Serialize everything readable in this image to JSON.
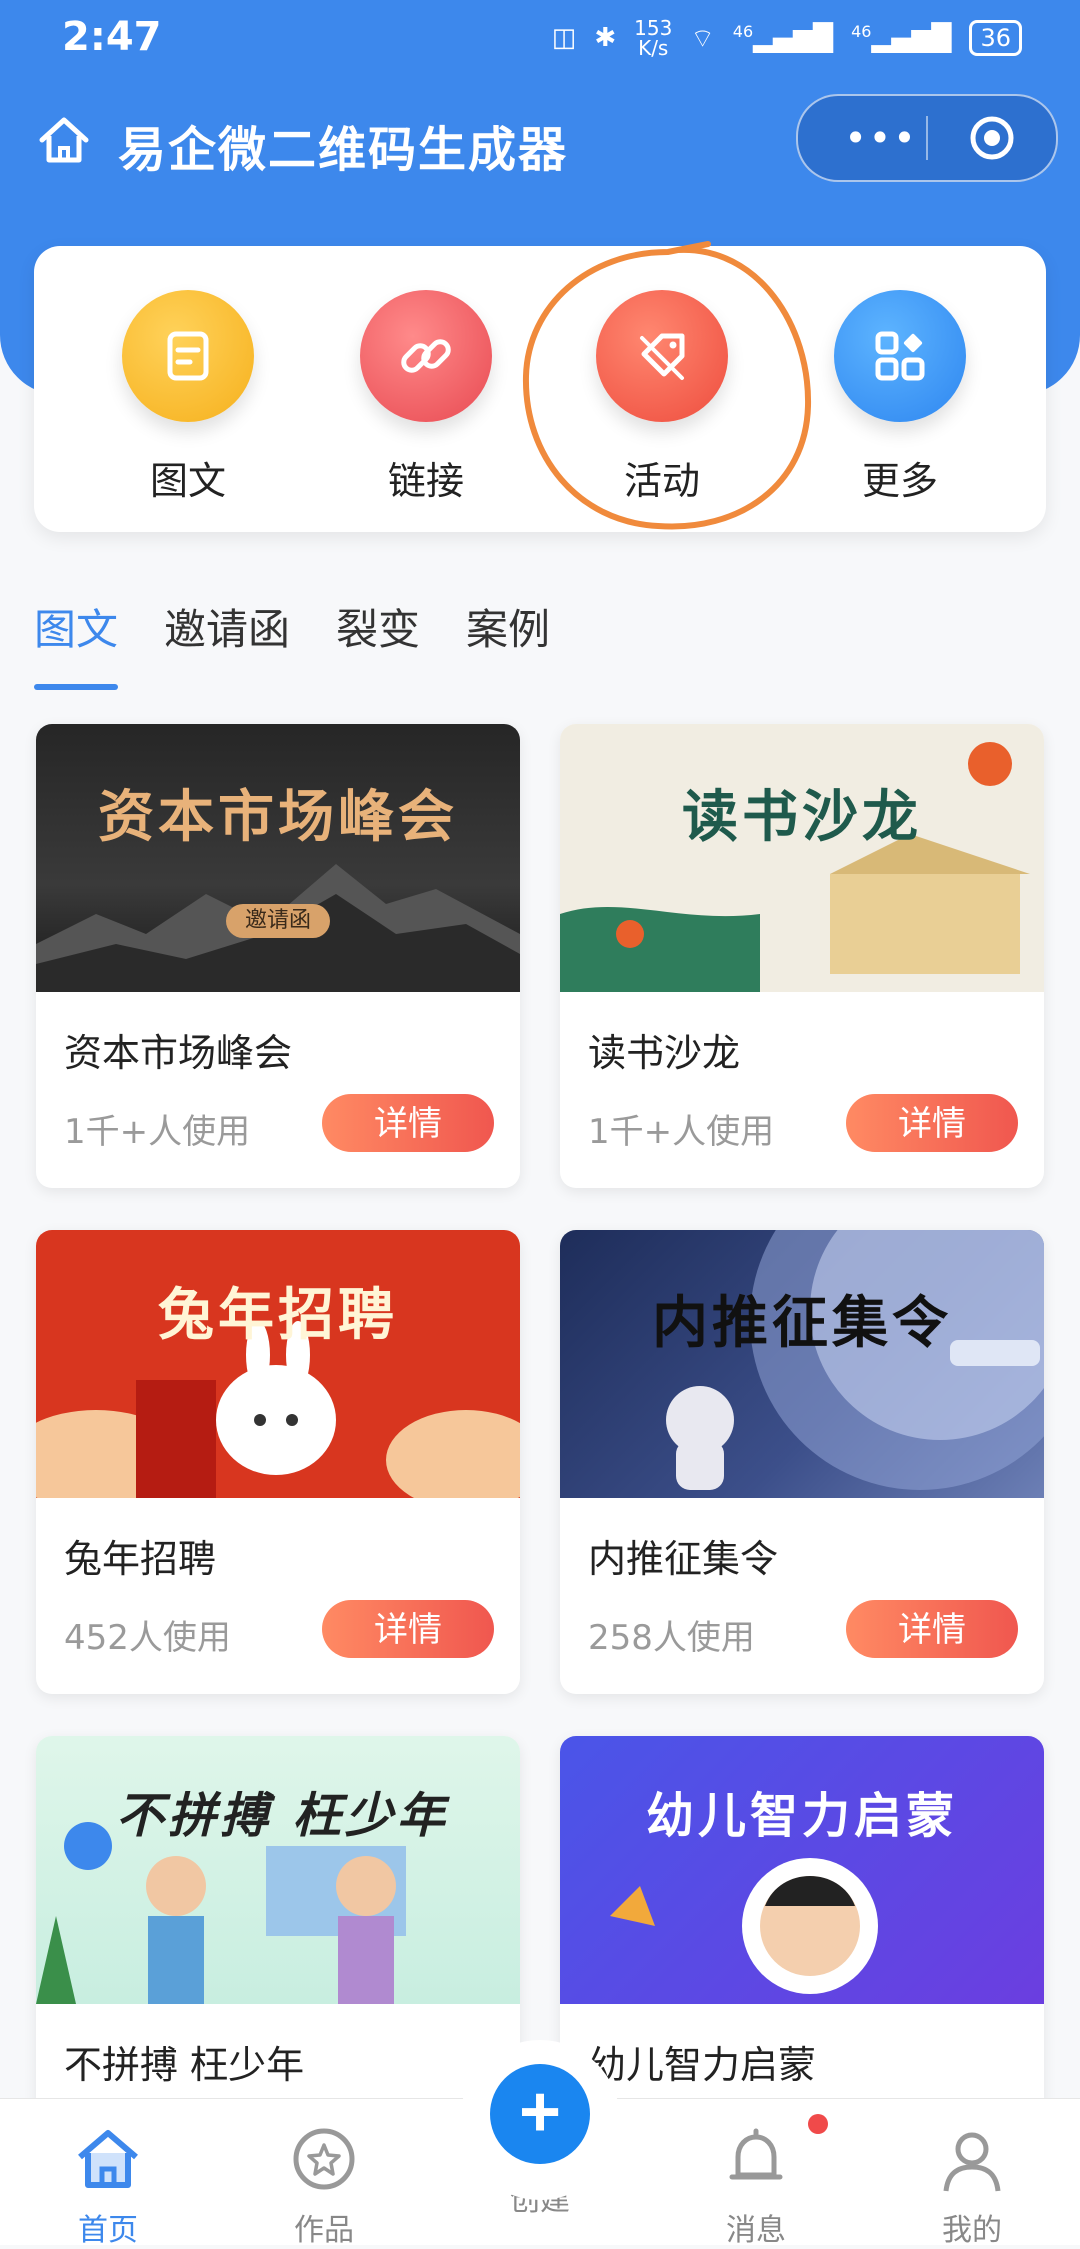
{
  "status_bar": {
    "time": "2:47",
    "net_speed_top": "153",
    "net_speed_unit": "K/s",
    "sig1": "46",
    "sig2": "46",
    "battery": "36"
  },
  "header": {
    "title": "易企微二维码生成器",
    "more": "•••"
  },
  "categories": [
    {
      "label": "图文",
      "icon": "document-icon",
      "color": "#f6b01c"
    },
    {
      "label": "链接",
      "icon": "link-icon",
      "color": "#e84a52"
    },
    {
      "label": "活动",
      "icon": "tag-icon",
      "color": "#ee4d3e"
    },
    {
      "label": "更多",
      "icon": "grid-icon",
      "color": "#2e86f0"
    }
  ],
  "tabs": [
    "图文",
    "邀请函",
    "裂变",
    "案例"
  ],
  "templates": [
    {
      "banner_text": "资本市场峰会",
      "badge": "邀请函",
      "name": "资本市场峰会",
      "uses": "1千+人使用",
      "action": "详情"
    },
    {
      "banner_text": "读书沙龙",
      "name": "读书沙龙",
      "uses": "1千+人使用",
      "action": "详情"
    },
    {
      "banner_text": "兔年招聘",
      "name": "兔年招聘",
      "uses": "452人使用",
      "action": "详情"
    },
    {
      "banner_text": "内推征集令",
      "name": "内推征集令",
      "uses": "258人使用",
      "action": "详情"
    },
    {
      "banner_text": "不拼搏 枉少年",
      "name": "不拼搏 枉少年"
    },
    {
      "banner_text": "幼儿智力启蒙",
      "name": "幼儿智力启蒙"
    }
  ],
  "bottom_nav": [
    {
      "label": "首页",
      "icon": "home-icon",
      "active": true
    },
    {
      "label": "作品",
      "icon": "star-badge-icon"
    },
    {
      "label": "创建",
      "icon": "plus-icon"
    },
    {
      "label": "消息",
      "icon": "bell-icon"
    },
    {
      "label": "我的",
      "icon": "user-icon"
    }
  ],
  "colors": {
    "primary": "#3d88ec",
    "detail_button": "#f0574f",
    "annotation": "#f08a3c"
  }
}
